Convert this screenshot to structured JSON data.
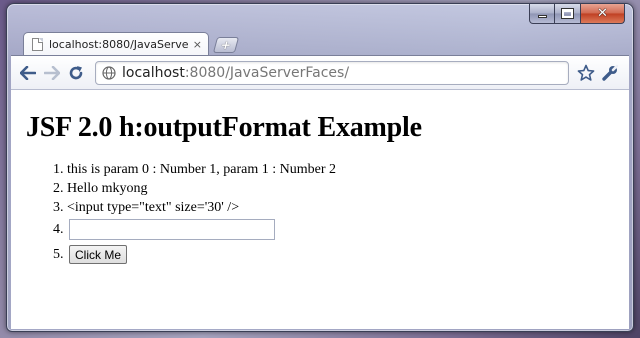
{
  "tab": {
    "title": "localhost:8080/JavaServer...",
    "close_glyph": "×",
    "new_tab_glyph": "+"
  },
  "window_controls": {
    "close_glyph": "✕"
  },
  "address_bar": {
    "host": "localhost",
    "rest": ":8080/JavaServerFaces/"
  },
  "page": {
    "heading": "JSF 2.0 h:outputFormat Example",
    "items": [
      "this is param 0 : Number 1, param 1 : Number 2",
      "Hello mkyong",
      "<input type=\"text\" size='30' />"
    ],
    "input_value": "",
    "button_label": "Click Me"
  },
  "icons": {
    "back": "back-arrow-icon",
    "forward": "forward-arrow-icon",
    "reload": "reload-icon",
    "site": "globe-icon",
    "bookmark": "star-icon",
    "settings": "wrench-icon"
  },
  "colors": {
    "close_button": "#c9482a",
    "toolbar_icon": "#3f5c8a"
  }
}
